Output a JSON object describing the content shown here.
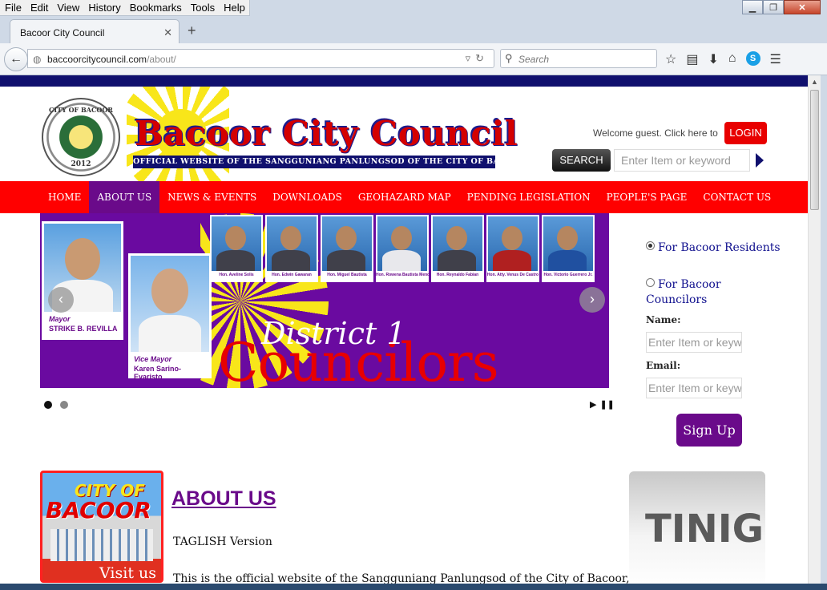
{
  "browser": {
    "menu": [
      "File",
      "Edit",
      "View",
      "History",
      "Bookmarks",
      "Tools",
      "Help"
    ],
    "tab_title": "Bacoor City Council",
    "url_host": "baccoorcitycouncil.com",
    "url_path": "/about/",
    "search_placeholder": "Search"
  },
  "header": {
    "seal_top": "CITY OF BACOOR",
    "seal_year": "2012",
    "title": "Bacoor City Council",
    "subtitle": "OFFICIAL WEBSITE OF THE SANGGUNIANG PANLUNGSOD OF THE CITY OF BACOOR, CAVITE",
    "welcome": "Welcome guest. Click here to",
    "login": "LOGIN",
    "search_button": "SEARCH",
    "search_placeholder": "Enter Item or keyword"
  },
  "nav": [
    "HOME",
    "ABOUT US",
    "NEWS & EVENTS",
    "DOWNLOADS",
    "GEOHAZARD MAP",
    "PENDING LEGISLATION",
    "PEOPLE'S PAGE",
    "CONTACT US"
  ],
  "nav_active": "ABOUT US",
  "slider": {
    "mayor_role": "Mayor",
    "mayor_name": "STRIKE B. REVILLA",
    "vice_role": "Vice Mayor",
    "vice_name": "Karen Sarino-Evaristo",
    "councilors": [
      "Hon. Aveline Solis",
      "Hon. Edwin Gawaran",
      "Hon. Miguel Bautista",
      "Hon. Rowena Bautista Mendiola",
      "Hon. Reynaldo Fabian",
      "Hon. Atty. Venus De Castro",
      "Hon. Victorio Guerrero Jr."
    ],
    "heading": "District 1",
    "subheading": "Councilors",
    "prev": "‹",
    "next": "›"
  },
  "sidebar": {
    "radio1": "For Bacoor Residents",
    "radio2": "For Bacoor Councilors",
    "name_label": "Name:",
    "email_label": "Email:",
    "name_placeholder": "Enter Item or keyword",
    "email_placeholder": "Enter Item or keyword",
    "signup": "Sign Up"
  },
  "content": {
    "card_city": "CITY OF",
    "card_bacoor": "BACOOR",
    "card_visit": "Visit us",
    "about_heading": "ABOUT US",
    "taglish": "TAGLISH Version",
    "body": "This is the official website of the Sangguniang Panlungsod of the City of Bacoor,",
    "tinig": "TINIG"
  },
  "colors": {
    "nav_red": "#ff0000",
    "purple": "#6a0a8a",
    "navy": "#10106e"
  }
}
